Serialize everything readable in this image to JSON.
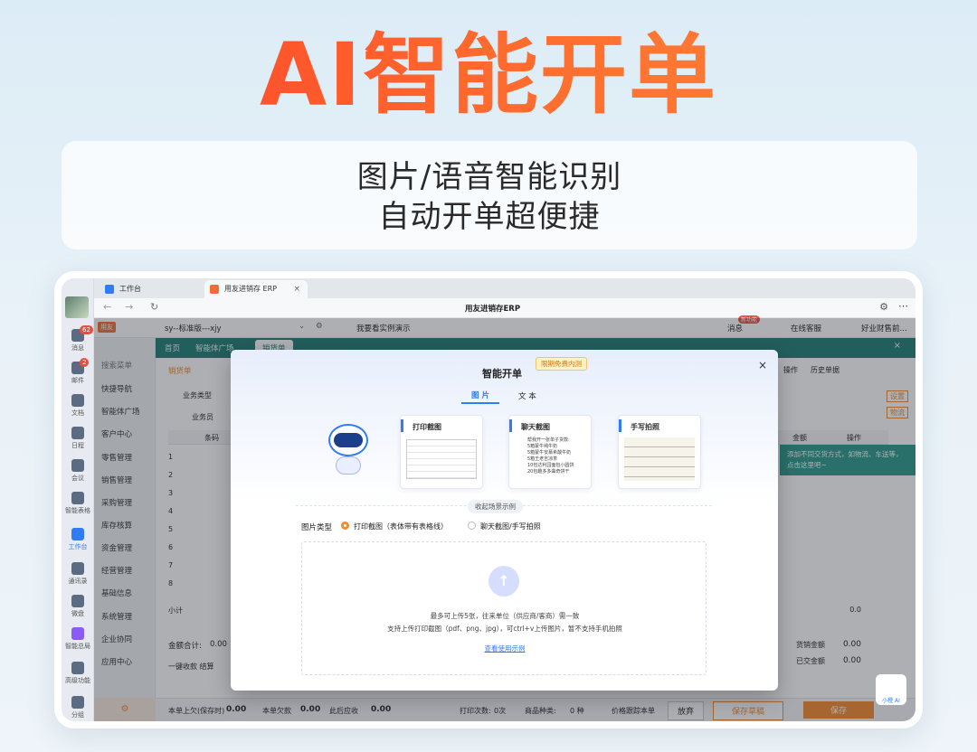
{
  "headline": "AI智能开单",
  "subline1": "图片/语音智能识别",
  "subline2": "自动开单超便捷",
  "leftbar": [
    {
      "label": "消息",
      "badge": "62"
    },
    {
      "label": "邮件",
      "badge": "2"
    },
    {
      "label": "文档"
    },
    {
      "label": "日程"
    },
    {
      "label": "会议"
    },
    {
      "label": "智能表格"
    },
    {
      "label": "工作台"
    },
    {
      "label": "通讯录"
    },
    {
      "label": "微盘"
    },
    {
      "label": "智能总局"
    },
    {
      "label": "高级功能"
    },
    {
      "label": "分组"
    }
  ],
  "tabs": {
    "t1": "工作台",
    "t2": "用友进销存 ERP"
  },
  "address_title": "用友进销存ERP",
  "erp": {
    "account": "sy--标准版---xjy",
    "demo": "我要看实例演示",
    "message": "消息",
    "msg_badge": "新功能",
    "service": "在线客服",
    "company": "好业财售前..."
  },
  "green": {
    "home": "首页",
    "plaza": "智能体广场",
    "sales": "销货单"
  },
  "menu": [
    "搜索菜单",
    "快捷导航",
    "智能体广场",
    "客户中心",
    "零售管理",
    "销售管理",
    "采购管理",
    "库存核算",
    "资金管理",
    "经营管理",
    "基础信息",
    "系统管理",
    "企业协同",
    "应用中心"
  ],
  "main": {
    "radio": "销货单",
    "biz_type": "业务类型",
    "salesman": "业务员",
    "col_code": "条码",
    "col_amount": "金额",
    "col_op": "操作",
    "subtotal": "小计",
    "subtotal_val": "0.0",
    "total": "金额合计:",
    "total_val": "0.00",
    "one_key": "一键收款 结算",
    "op": "操作",
    "history": "历史单据",
    "settings": "设置",
    "logistics": "物流",
    "tip": "添加不同交货方式，如物流、车送等，点击这里吧~",
    "right_a": "货销金额",
    "right_b": "已交金额",
    "right_a_val": "0.00",
    "right_b_val": "0.00",
    "rows": [
      "1",
      "2",
      "3",
      "4",
      "5",
      "6",
      "7",
      "8"
    ]
  },
  "footer": {
    "a": "本单上欠(保存时)",
    "a_val": "0.00",
    "b": "本单欠款",
    "b_val": "0.00",
    "c": "此后应收",
    "c_val": "0.00",
    "print": "打印次数:",
    "print_val": "0次",
    "kinds": "商品种类:",
    "kinds_val": "0 种",
    "trace": "价格跟踪本单",
    "discard": "放弃",
    "draft": "保存草稿",
    "save": "保存"
  },
  "modal": {
    "title": "智能开单",
    "promo": "限期免费内测",
    "tab_image": "图 片",
    "tab_text": "文 本",
    "card1": "打印截图",
    "card2": "聊天截图",
    "card3": "手写拍照",
    "card2_lines": [
      "帮我开一张单子货款:",
      "5箱蒙牛纯牛奶",
      "5箱蒙牛安慕希酸牛奶",
      "5箱王老吉凉茶",
      "10包达利园面包小圆饼",
      "20包趣多多曲奇饼干"
    ],
    "collapse": "收起场景示例",
    "type_label": "图片类型",
    "opt1": "打印截图（表体带有表格线）",
    "opt2": "聊天截图/手写拍照",
    "upload1": "最多可上传5张，往来单位（供应商/客商）需一致",
    "upload2": "支持上传打印截图（pdf、png、jpg），可ctrl+v上传图片，暂不支持手机拍照",
    "usage": "查看使用示例"
  },
  "assistant": "小橙 AI",
  "colors": {
    "accent": "#2f7cf6",
    "orange": "#f58a2a",
    "teal": "#1f7c73"
  }
}
